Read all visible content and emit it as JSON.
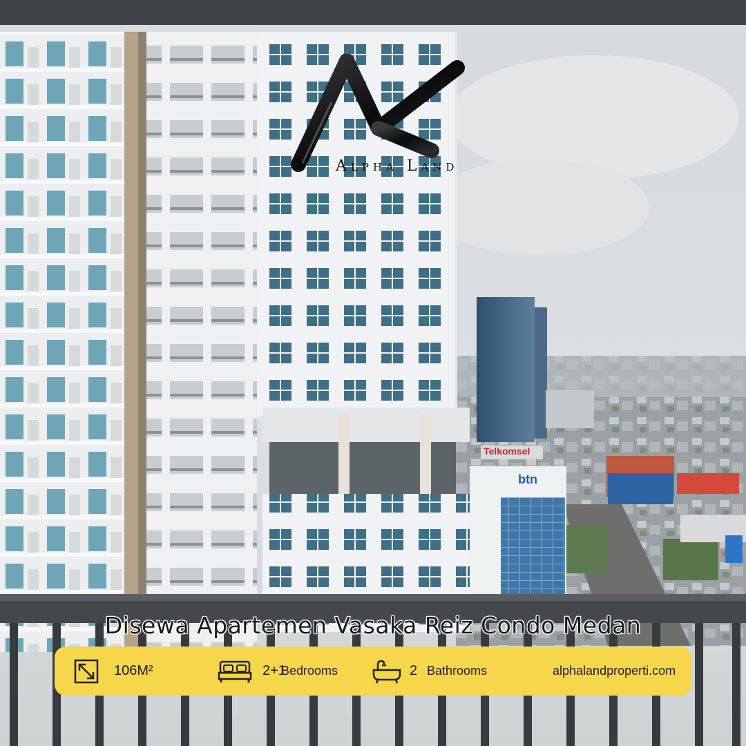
{
  "brand": {
    "name": "Alpha Land"
  },
  "headline": "Disewa Apartemen Vasaka Reiz Condo Medan",
  "signs": {
    "telkomsel": "Telkomsel",
    "btn": "btn"
  },
  "info": {
    "area": "106M²",
    "bedrooms_count": "2+1",
    "bedrooms_label": "Bedrooms",
    "bathrooms_count": "2",
    "bathrooms_label": "Bathrooms",
    "website": "alphalandproperti.com"
  },
  "colors": {
    "banner": "#f6d64a",
    "sky": "#d9dde0",
    "facade": "#eef0f1",
    "glass": "#5d9ab0",
    "railing": "#3a3c3e"
  }
}
